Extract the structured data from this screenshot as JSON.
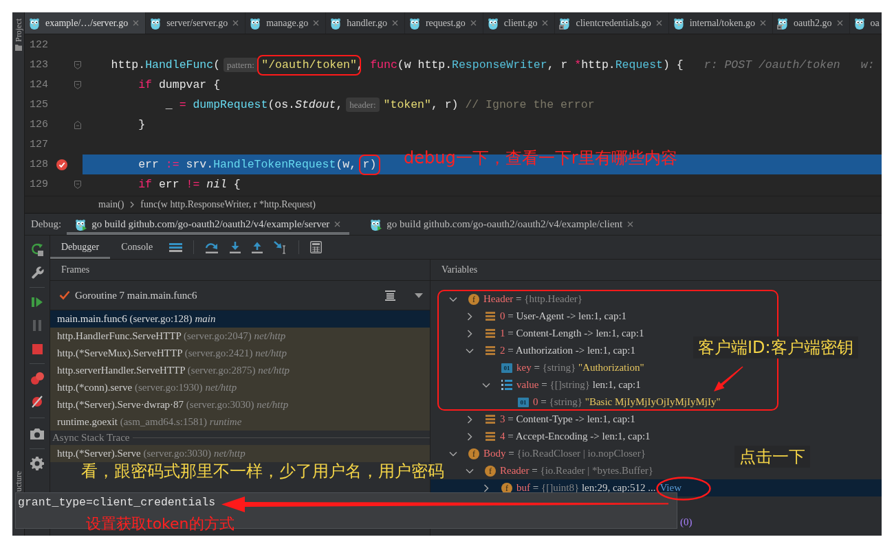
{
  "side_strip": {
    "top_label": "Project",
    "bottom_label": "ucture"
  },
  "editor_tabs": [
    {
      "label": "example/…/server.go",
      "selected": true,
      "locked": false
    },
    {
      "label": "server/server.go",
      "selected": false,
      "locked": false
    },
    {
      "label": "manage.go",
      "selected": false,
      "locked": false
    },
    {
      "label": "handler.go",
      "selected": false,
      "locked": false
    },
    {
      "label": "request.go",
      "selected": false,
      "locked": false
    },
    {
      "label": "client.go",
      "selected": false,
      "locked": false
    },
    {
      "label": "clientcredentials.go",
      "selected": false,
      "locked": true
    },
    {
      "label": "internal/token.go",
      "selected": false,
      "locked": false
    },
    {
      "label": "oauth2.go",
      "selected": false,
      "locked": true
    },
    {
      "label": "oa",
      "selected": false,
      "locked": false
    }
  ],
  "editor": {
    "lines": [
      {
        "number": "122",
        "current": false,
        "breakpoint": false
      },
      {
        "number": "123",
        "current": false,
        "breakpoint": false,
        "fold": {
          "kind": "start"
        },
        "segments": [
          {
            "kind": "code",
            "circled": false,
            "tokens": [
              {
                "text": "    http.",
                "kind": "plain"
              },
              {
                "text": "HandleFunc",
                "kind": "call"
              },
              {
                "text": "(",
                "kind": "plain"
              }
            ]
          },
          {
            "kind": "hint",
            "circled": false,
            "text": "pattern:"
          },
          {
            "kind": "code",
            "circled": true,
            "tokens": [
              {
                "text": "\"/oauth/token\"",
                "kind": "string"
              }
            ]
          },
          {
            "kind": "code",
            "circled": false,
            "tokens": [
              {
                "text": ", ",
                "kind": "plain"
              },
              {
                "text": "func",
                "kind": "keyword"
              },
              {
                "text": "(w http.",
                "kind": "plain"
              },
              {
                "text": "ResponseWriter",
                "kind": "type"
              },
              {
                "text": ", r ",
                "kind": "plain"
              },
              {
                "text": "*",
                "kind": "keyword"
              },
              {
                "text": "http.",
                "kind": "plain"
              },
              {
                "text": "Request",
                "kind": "type"
              },
              {
                "text": ") {",
                "kind": "plain"
              }
            ]
          }
        ],
        "inline_values": [
          "r: POST /oauth/token",
          "w:"
        ]
      },
      {
        "number": "124",
        "current": false,
        "breakpoint": false,
        "fold": {
          "kind": "start"
        },
        "segments": [
          {
            "kind": "code",
            "circled": false,
            "tokens": [
              {
                "text": "        if",
                "kind": "keyword"
              },
              {
                "text": " dumpvar {",
                "kind": "plain"
              }
            ]
          }
        ]
      },
      {
        "number": "125",
        "current": false,
        "breakpoint": false,
        "segments": [
          {
            "kind": "code",
            "circled": false,
            "tokens": [
              {
                "text": "            _ ",
                "kind": "plain"
              },
              {
                "text": "=",
                "kind": "keyword"
              },
              {
                "text": " dumpRequest",
                "kind": "call"
              },
              {
                "text": "(os.",
                "kind": "plain"
              },
              {
                "text": "Stdout",
                "kind": "italic"
              },
              {
                "text": ",",
                "kind": "plain"
              }
            ]
          },
          {
            "kind": "hint",
            "circled": false,
            "text": "header:"
          },
          {
            "kind": "code",
            "circled": false,
            "tokens": [
              {
                "text": "\"token\"",
                "kind": "string"
              },
              {
                "text": ", r) ",
                "kind": "plain"
              },
              {
                "text": "// Ignore the error",
                "kind": "comment"
              }
            ]
          }
        ]
      },
      {
        "number": "126",
        "current": false,
        "breakpoint": false,
        "fold": {
          "kind": "end"
        },
        "segments": [
          {
            "kind": "code",
            "circled": false,
            "tokens": [
              {
                "text": "        }",
                "kind": "plain"
              }
            ]
          }
        ]
      },
      {
        "number": "127",
        "current": false,
        "breakpoint": false
      },
      {
        "number": "128",
        "current": true,
        "breakpoint": true,
        "segments": [
          {
            "kind": "code",
            "circled": false,
            "tokens": [
              {
                "text": "        err ",
                "kind": "plain"
              },
              {
                "text": ":=",
                "kind": "keyword"
              },
              {
                "text": " srv.",
                "kind": "plain"
              },
              {
                "text": "HandleTokenRequest",
                "kind": "call"
              },
              {
                "text": "(w, ",
                "kind": "plain"
              }
            ]
          },
          {
            "kind": "code",
            "circled": true,
            "tokens": [
              {
                "text": "r)",
                "kind": "plain"
              }
            ]
          }
        ]
      },
      {
        "number": "129",
        "current": false,
        "breakpoint": false,
        "fold": {
          "kind": "start"
        },
        "segments": [
          {
            "kind": "code",
            "circled": false,
            "tokens": [
              {
                "text": "        if",
                "kind": "keyword"
              },
              {
                "text": " err ",
                "kind": "plain"
              },
              {
                "text": "!=",
                "kind": "keyword"
              },
              {
                "text": " nil",
                "kind": "italic"
              },
              {
                "text": " {",
                "kind": "plain"
              }
            ]
          }
        ]
      }
    ]
  },
  "breadcrumb": [
    "main()",
    "func(w http.ResponseWriter, r *http.Request)"
  ],
  "debug": {
    "label": "Debug:",
    "run_tabs": [
      {
        "label": "go build github.com/go-oauth2/oauth2/v4/example/server",
        "selected": true
      },
      {
        "label": "go build github.com/go-oauth2/oauth2/v4/example/client",
        "selected": false
      }
    ],
    "view_tabs": [
      {
        "label": "Debugger",
        "selected": true
      },
      {
        "label": "Console",
        "selected": false
      }
    ],
    "frames": {
      "title": "Frames",
      "thread": "Goroutine 7 main.main.func6",
      "items": [
        {
          "function": "main.main.func6",
          "location": "(server.go:128)",
          "package": "main",
          "selected": true,
          "library": false
        },
        {
          "function": "http.HandlerFunc.ServeHTTP",
          "location": "(server.go:2047)",
          "package": "net/http",
          "selected": false,
          "library": true
        },
        {
          "function": "http.(*ServeMux).ServeHTTP",
          "location": "(server.go:2421)",
          "package": "net/http",
          "selected": false,
          "library": true
        },
        {
          "function": "http.serverHandler.ServeHTTP",
          "location": "(server.go:2875)",
          "package": "net/http",
          "selected": false,
          "library": true
        },
        {
          "function": "http.(*conn).serve",
          "location": "(server.go:1930)",
          "package": "net/http",
          "selected": false,
          "library": true
        },
        {
          "function": "http.(*Server).Serve·dwrap·87",
          "location": "(server.go:3030)",
          "package": "net/http",
          "selected": false,
          "library": true
        },
        {
          "function": "runtime.goexit",
          "location": "(asm_amd64.s:1581)",
          "package": "runtime",
          "selected": false,
          "library": true
        }
      ],
      "async_title": "Async Stack Trace",
      "async_items": [
        {
          "function": "http.(*Server).Serve",
          "location": "(server.go:3030)",
          "package": "net/http",
          "selected": false,
          "library": true
        }
      ]
    },
    "variables": {
      "title": "Variables",
      "tree": [
        {
          "name": "Header",
          "op": "=",
          "type": "{http.Header}",
          "kind": "field",
          "badge": "f",
          "expanded": true,
          "selected": false,
          "children": [
            {
              "name": "0",
              "op": "=",
              "value": "User-Agent -> len:1, cap:1",
              "kind": "entry",
              "expanded": false,
              "selected": false
            },
            {
              "name": "1",
              "op": "=",
              "value": "Content-Length -> len:1, cap:1",
              "kind": "entry",
              "expanded": false,
              "selected": false
            },
            {
              "name": "2",
              "op": "=",
              "value": "Authorization -> len:1, cap:1",
              "kind": "entry",
              "expanded": true,
              "selected": false,
              "children": [
                {
                  "name": "key",
                  "op": "=",
                  "type": "{string}",
                  "value": "\"Authorization\"",
                  "kind": "string",
                  "badge": "01",
                  "selected": false
                },
                {
                  "name": "value",
                  "op": "=",
                  "type": "{[]string}",
                  "value": "len:1, cap:1",
                  "kind": "slice",
                  "expanded": true,
                  "selected": false,
                  "children": [
                    {
                      "name": "0",
                      "op": "=",
                      "type": "{string}",
                      "value": "\"Basic MjIyMjIyOjIyMjIyMjIy\"",
                      "kind": "string",
                      "badge": "01",
                      "selected": false
                    }
                  ]
                }
              ]
            },
            {
              "name": "3",
              "op": "=",
              "value": "Content-Type -> len:1, cap:1",
              "kind": "entry",
              "expanded": false,
              "selected": false
            },
            {
              "name": "4",
              "op": "=",
              "value": "Accept-Encoding -> len:1, cap:1",
              "kind": "entry",
              "expanded": false,
              "selected": false
            }
          ]
        },
        {
          "name": "Body",
          "op": "=",
          "type": "{io.ReadCloser | io.nopCloser}",
          "kind": "field",
          "badge": "f",
          "expanded": true,
          "selected": false,
          "children": [
            {
              "name": "Reader",
              "op": "=",
              "type": "{io.Reader | *bytes.Buffer}",
              "kind": "field",
              "badge": "f",
              "expanded": true,
              "selected": false,
              "children": [
                {
                  "name": "buf",
                  "op": "=",
                  "type": "{[]uint8}",
                  "value": "len:29, cap:512 ...",
                  "link": "View",
                  "kind": "field",
                  "badge": "f",
                  "expanded": false,
                  "selected": true
                },
                {
                  "value": "(0)",
                  "kind": "covered",
                  "selected": false
                }
              ]
            }
          ]
        }
      ]
    },
    "popup": "grant_type=client_credentials"
  },
  "annotations": [
    {
      "text": "debug一下，查看一下r里有哪些内容",
      "color": "#ff2020"
    },
    {
      "text": "客户端ID:客户端密钥",
      "color": "#f5d547"
    },
    {
      "text": "点击一下",
      "color": "#f5d547"
    },
    {
      "text": "看，跟密码式那里不一样，少了用户名，用户密码",
      "color": "#f5d547"
    },
    {
      "text": "设置获取token的方式",
      "color": "#ff2020"
    }
  ]
}
